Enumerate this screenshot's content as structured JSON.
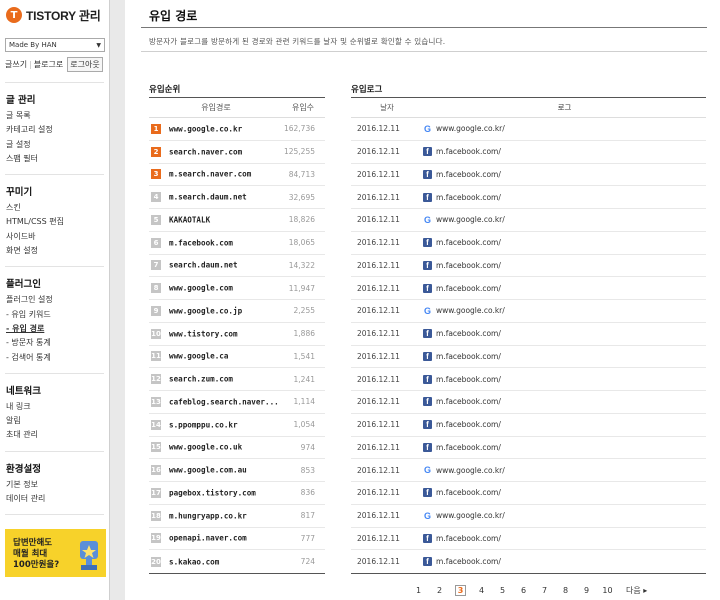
{
  "app": {
    "logo_mark": "T",
    "logo_text": "TISTORY 관리"
  },
  "sidebar": {
    "blog_select": "Made By HAN",
    "quick": {
      "write": "글쓰기",
      "blog": "블로그로",
      "logout": "로그아웃"
    },
    "groups": [
      {
        "title": "글 관리",
        "items": [
          "글 목록",
          "카테고리 설정",
          "글 설정",
          "스팸 필터"
        ]
      },
      {
        "title": "꾸미기",
        "items": [
          "스킨",
          "HTML/CSS 편집",
          "사이드바",
          "화면 설정"
        ]
      },
      {
        "title": "플러그인",
        "items": [
          "플러그인 설정",
          "- 유입 키워드",
          "- 유입 경로",
          "- 방문자 통계",
          "- 검색어 통계"
        ]
      },
      {
        "title": "네트워크",
        "items": [
          "내 링크",
          "알림",
          "초대 관리"
        ]
      },
      {
        "title": "환경설정",
        "items": [
          "기본 정보",
          "데이터 관리"
        ]
      }
    ],
    "ad": {
      "line1": "답변만해도",
      "line2": "매월 최대",
      "line3": "100만원을?"
    }
  },
  "main": {
    "title": "유입 경로",
    "description": "방문자가 블로그를 방문하게 된 경로와 관련 키워드를 날자 및 순위별로 확인할 수 있습니다.",
    "rank": {
      "label": "유입순위",
      "col_source": "유입경로",
      "col_count": "유입수",
      "rows": [
        {
          "rank": "1",
          "source": "www.google.co.kr",
          "count": "162,736"
        },
        {
          "rank": "2",
          "source": "search.naver.com",
          "count": "125,255"
        },
        {
          "rank": "3",
          "source": "m.search.naver.com",
          "count": "84,713"
        },
        {
          "rank": "4",
          "source": "m.search.daum.net",
          "count": "32,695"
        },
        {
          "rank": "5",
          "source": "KAKAOTALK",
          "count": "18,826"
        },
        {
          "rank": "6",
          "source": "m.facebook.com",
          "count": "18,065"
        },
        {
          "rank": "7",
          "source": "search.daum.net",
          "count": "14,322"
        },
        {
          "rank": "8",
          "source": "www.google.com",
          "count": "11,947"
        },
        {
          "rank": "9",
          "source": "www.google.co.jp",
          "count": "2,255"
        },
        {
          "rank": "10",
          "source": "www.tistory.com",
          "count": "1,886"
        },
        {
          "rank": "11",
          "source": "www.google.ca",
          "count": "1,541"
        },
        {
          "rank": "12",
          "source": "search.zum.com",
          "count": "1,241"
        },
        {
          "rank": "13",
          "source": "cafeblog.search.naver...",
          "count": "1,114"
        },
        {
          "rank": "14",
          "source": "s.ppomppu.co.kr",
          "count": "1,054"
        },
        {
          "rank": "15",
          "source": "www.google.co.uk",
          "count": "974"
        },
        {
          "rank": "16",
          "source": "www.google.com.au",
          "count": "853"
        },
        {
          "rank": "17",
          "source": "pagebox.tistory.com",
          "count": "836"
        },
        {
          "rank": "18",
          "source": "m.hungryapp.co.kr",
          "count": "817"
        },
        {
          "rank": "19",
          "source": "openapi.naver.com",
          "count": "777"
        },
        {
          "rank": "20",
          "source": "s.kakao.com",
          "count": "724"
        }
      ]
    },
    "log": {
      "label": "유입로그",
      "col_date": "날자",
      "col_log": "로그",
      "rows": [
        {
          "date": "2016.12.11",
          "icon": "google-icon",
          "url": "www.google.co.kr/"
        },
        {
          "date": "2016.12.11",
          "icon": "facebook-icon",
          "url": "m.facebook.com/"
        },
        {
          "date": "2016.12.11",
          "icon": "facebook-icon",
          "url": "m.facebook.com/"
        },
        {
          "date": "2016.12.11",
          "icon": "facebook-icon",
          "url": "m.facebook.com/"
        },
        {
          "date": "2016.12.11",
          "icon": "google-icon",
          "url": "www.google.co.kr/"
        },
        {
          "date": "2016.12.11",
          "icon": "facebook-icon",
          "url": "m.facebook.com/"
        },
        {
          "date": "2016.12.11",
          "icon": "facebook-icon",
          "url": "m.facebook.com/"
        },
        {
          "date": "2016.12.11",
          "icon": "facebook-icon",
          "url": "m.facebook.com/"
        },
        {
          "date": "2016.12.11",
          "icon": "google-icon",
          "url": "www.google.co.kr/"
        },
        {
          "date": "2016.12.11",
          "icon": "facebook-icon",
          "url": "m.facebook.com/"
        },
        {
          "date": "2016.12.11",
          "icon": "facebook-icon",
          "url": "m.facebook.com/"
        },
        {
          "date": "2016.12.11",
          "icon": "facebook-icon",
          "url": "m.facebook.com/"
        },
        {
          "date": "2016.12.11",
          "icon": "facebook-icon",
          "url": "m.facebook.com/"
        },
        {
          "date": "2016.12.11",
          "icon": "facebook-icon",
          "url": "m.facebook.com/"
        },
        {
          "date": "2016.12.11",
          "icon": "facebook-icon",
          "url": "m.facebook.com/"
        },
        {
          "date": "2016.12.11",
          "icon": "google-icon",
          "url": "www.google.co.kr/"
        },
        {
          "date": "2016.12.11",
          "icon": "facebook-icon",
          "url": "m.facebook.com/"
        },
        {
          "date": "2016.12.11",
          "icon": "google-icon",
          "url": "www.google.co.kr/"
        },
        {
          "date": "2016.12.11",
          "icon": "facebook-icon",
          "url": "m.facebook.com/"
        },
        {
          "date": "2016.12.11",
          "icon": "facebook-icon",
          "url": "m.facebook.com/"
        }
      ]
    },
    "pagination": {
      "pages": [
        "1",
        "2",
        "3",
        "4",
        "5",
        "6",
        "7",
        "8",
        "9",
        "10"
      ],
      "current": "3",
      "next": "다음 ▸"
    }
  },
  "colors": {
    "accent": "#e96b1c",
    "facebook": "#3b5998",
    "google": "#4285f4",
    "ad_bg": "#f7d22a"
  }
}
